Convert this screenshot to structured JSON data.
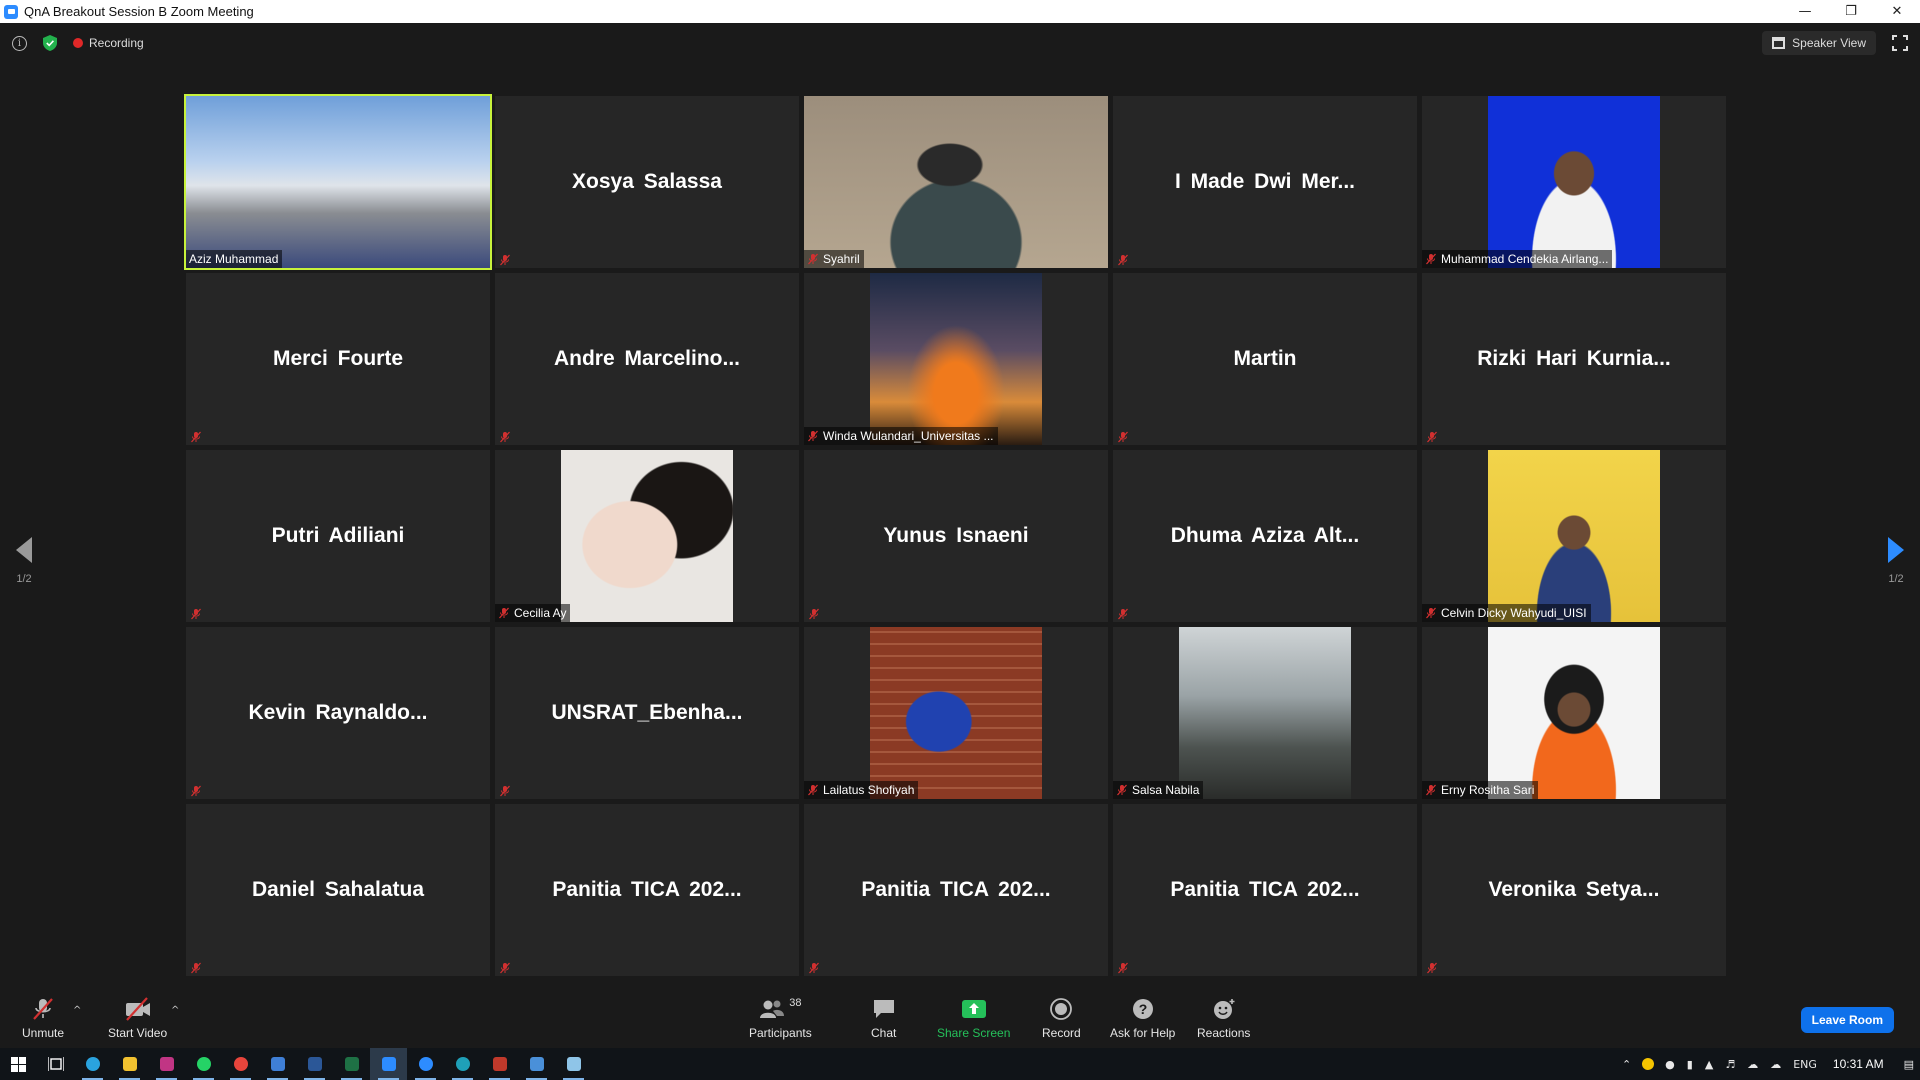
{
  "window": {
    "title": "QnA Breakout Session B   Zoom Meeting"
  },
  "topbar": {
    "recording_label": "Recording",
    "speaker_view_label": "Speaker View"
  },
  "colors": {
    "active_speaker": "#c7f23b",
    "share_green": "#25c05a",
    "leave_blue": "#0e71eb",
    "muted_red": "#d23030"
  },
  "tiles": [
    {
      "name": "Aziz Muhammad",
      "video": true,
      "active": true
    },
    {
      "name": "Xosya Salassa",
      "video": false
    },
    {
      "name": "Syahril",
      "video": true
    },
    {
      "name": "I Made Dwi Mer...",
      "video": false
    },
    {
      "name": "Muhammad Cendekia Airlang...",
      "video": true
    },
    {
      "name": "Merci Fourte",
      "video": false
    },
    {
      "name": "Andre  Marcelino...",
      "video": false
    },
    {
      "name": "Winda Wulandari_Universitas ...",
      "video": true
    },
    {
      "name": "Martin",
      "video": false
    },
    {
      "name": "Rizki Hari Kurnia...",
      "video": false
    },
    {
      "name": "Putri Adiliani",
      "video": false
    },
    {
      "name": "Cecilia Ay",
      "video": true
    },
    {
      "name": "Yunus Isnaeni",
      "video": false
    },
    {
      "name": "Dhuma Aziza Alt...",
      "video": false
    },
    {
      "name": "Celvin Dicky Wahyudi_UISI",
      "video": true
    },
    {
      "name": "Kevin  Raynaldo...",
      "video": false
    },
    {
      "name": "UNSRAT_Ebenha...",
      "video": false
    },
    {
      "name": "Lailatus Shofiyah",
      "video": true
    },
    {
      "name": "Salsa Nabila",
      "video": true
    },
    {
      "name": "Erny Rositha Sari",
      "video": true
    },
    {
      "name": "Daniel Sahalatua",
      "video": false
    },
    {
      "name": "Panitia TICA 202...",
      "video": false
    },
    {
      "name": "Panitia TICA 202...",
      "video": false
    },
    {
      "name": "Panitia TICA 202...",
      "video": false
    },
    {
      "name": "Veronika Setya...",
      "video": false
    }
  ],
  "pager": {
    "left": "1/2",
    "right": "1/2"
  },
  "toolbar": {
    "unmute": "Unmute",
    "start_video": "Start Video",
    "participants": "Participants",
    "participants_count": "38",
    "chat": "Chat",
    "share_screen": "Share Screen",
    "record": "Record",
    "ask_for_help": "Ask for Help",
    "reactions": "Reactions",
    "leave_room": "Leave Room"
  },
  "taskbar": {
    "language": "ENG",
    "time": "10:31 AM"
  }
}
